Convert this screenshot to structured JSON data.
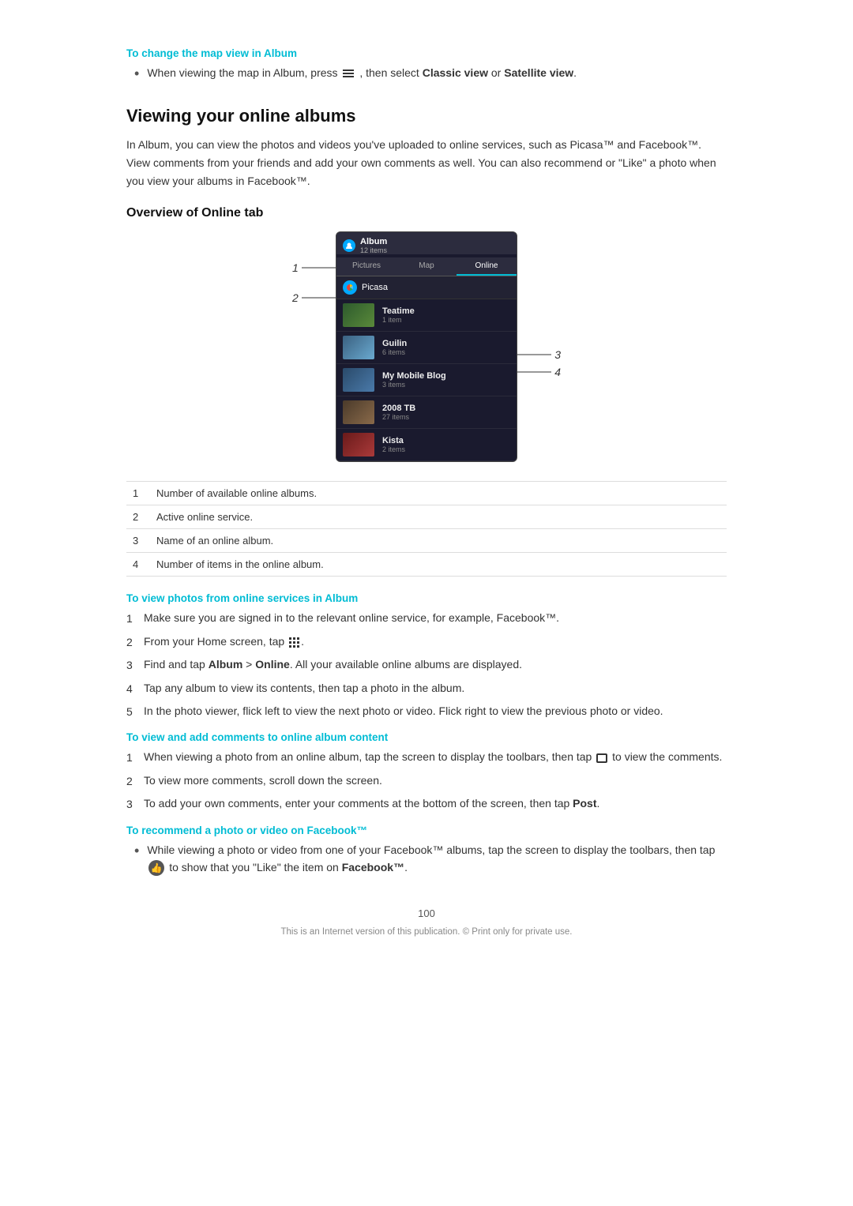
{
  "tip1": {
    "title": "To change the map view in Album",
    "bullet": "When viewing the map in Album, press",
    "bullet_cont": ", then select",
    "bold1": "Classic view",
    "or": " or ",
    "bold2": "Satellite view",
    "end": "."
  },
  "section": {
    "heading": "Viewing your online albums",
    "desc": "In Album, you can view the photos and videos you've uploaded to online services, such as Picasa™ and Facebook™. View comments from your friends and add your own comments as well. You can also recommend or \"Like\" a photo when you view your albums in Facebook™.",
    "sub_heading": "Overview of Online tab"
  },
  "mockup": {
    "app_title": "Album",
    "app_subtitle": "12 items",
    "tabs": [
      "Pictures",
      "Map",
      "Online"
    ],
    "active_tab": "Online",
    "service": "Picasa",
    "albums": [
      {
        "name": "Teatime",
        "count": "1 item",
        "thumb": "green"
      },
      {
        "name": "Guilin",
        "count": "6 items",
        "thumb": "sky"
      },
      {
        "name": "My Mobile Blog",
        "count": "3 items",
        "thumb": "blue"
      },
      {
        "name": "2008 TB",
        "count": "27 items",
        "thumb": "multi"
      },
      {
        "name": "Kista",
        "count": "2 items",
        "thumb": "red"
      }
    ]
  },
  "legend": [
    {
      "num": "1",
      "desc": "Number of available online albums."
    },
    {
      "num": "2",
      "desc": "Active online service."
    },
    {
      "num": "3",
      "desc": "Name of an online album."
    },
    {
      "num": "4",
      "desc": "Number of items in the online album."
    }
  ],
  "tip2": {
    "title": "To view photos from online services in Album",
    "steps": [
      "Make sure you are signed in to the relevant online service, for example, Facebook™.",
      "From your Home screen, tap ⋮⋮⋮.",
      "Find and tap Album > Online. All your available online albums are displayed.",
      "Tap any album to view its contents, then tap a photo in the album.",
      "In the photo viewer, flick left to view the next photo or video. Flick right to view the previous photo or video."
    ]
  },
  "tip3": {
    "title": "To view and add comments to online album content",
    "steps": [
      "When viewing a photo from an online album, tap the screen to display the toolbars, then tap □ to view the comments.",
      "To view more comments, scroll down the screen.",
      "To add your own comments, enter your comments at the bottom of the screen, then tap Post."
    ],
    "bold_post": "Post"
  },
  "tip4": {
    "title": "To recommend a photo or video on Facebook™",
    "bullet": "While viewing a photo or video from one of your Facebook™ albums, tap the screen to display the toolbars, then tap ♥ to show that you \"Like\" the item on",
    "bold_end": "Facebook™",
    "end": "."
  },
  "footer": {
    "page_num": "100",
    "note": "This is an Internet version of this publication. © Print only for private use."
  }
}
